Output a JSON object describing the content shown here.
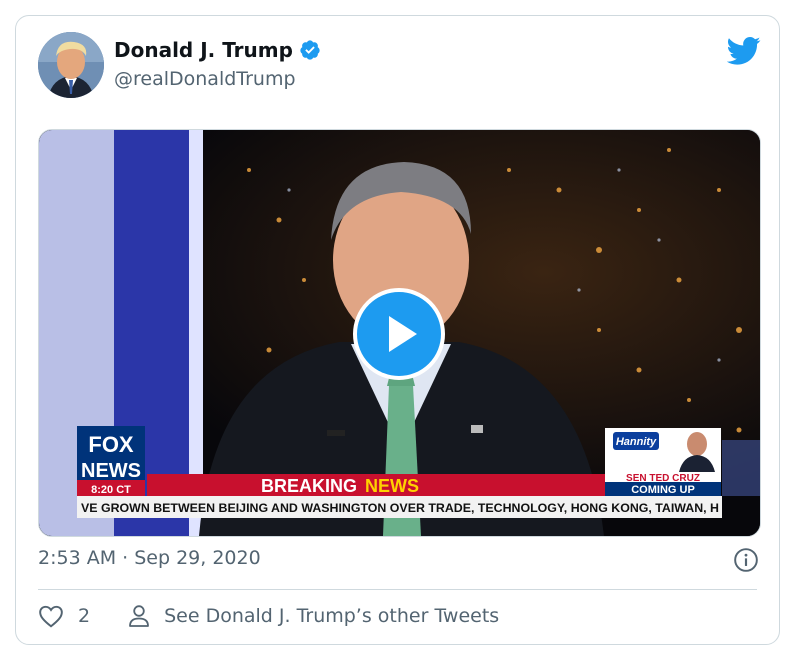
{
  "tweet": {
    "author_name": "Donald J. Trump",
    "author_handle": "@realDonaldTrump",
    "timestamp": "2:53 AM · Sep 29, 2020",
    "like_count": "2",
    "other_tweets_label": "See Donald J. Trump’s other Tweets"
  },
  "video": {
    "network_logo_line1": "FOX",
    "network_logo_line2": "NEWS",
    "breaking_word1": "BREAKING",
    "breaking_word2": "NEWS",
    "ticker_text": "VE GROWN BETWEEN BEIJING AND WASHINGTON OVER TRADE, TECHNOLOGY, HONG KONG, TAIWAN, H",
    "clock_text": "8:20 CT",
    "promo_show": "Hannity",
    "promo_line1": "SEN TED CRUZ",
    "promo_line2": "COMING UP"
  },
  "icons": {
    "verified": "verified-badge-icon",
    "twitter": "twitter-bird-icon",
    "play": "play-icon",
    "info": "info-icon",
    "like": "heart-icon",
    "profile": "person-icon"
  },
  "colors": {
    "twitter_blue": "#1d9bf0",
    "text_primary": "#0f1419",
    "text_secondary": "#536471",
    "breaking_red": "#c8102e",
    "breaking_yellow": "#ffd200",
    "fox_blue": "#00337a"
  }
}
